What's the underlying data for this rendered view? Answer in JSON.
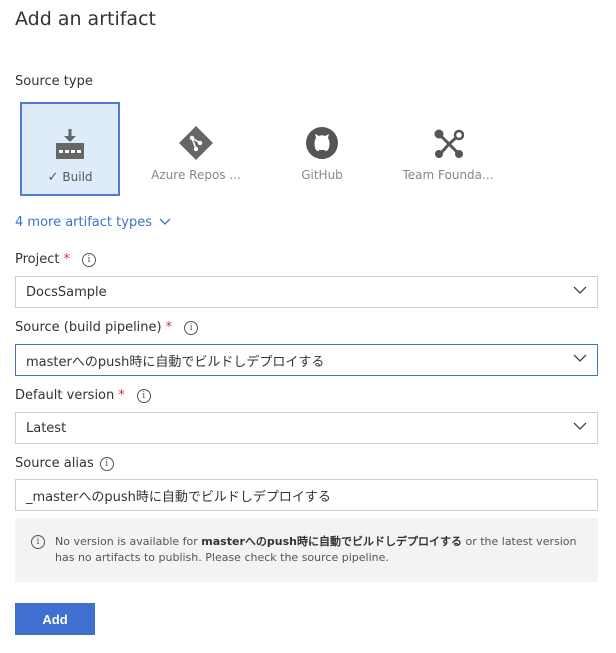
{
  "header": {
    "title": "Add an artifact"
  },
  "source_type": {
    "label": "Source type",
    "items": [
      {
        "label": "Build",
        "selected": true,
        "icon": "build-icon"
      },
      {
        "label": "Azure Repos ...",
        "selected": false,
        "icon": "git-icon"
      },
      {
        "label": "GitHub",
        "selected": false,
        "icon": "github-icon"
      },
      {
        "label": "Team Founda...",
        "selected": false,
        "icon": "tfvc-icon"
      }
    ],
    "more_link": "4 more artifact types"
  },
  "project": {
    "label": "Project",
    "value": "DocsSample"
  },
  "source": {
    "label": "Source (build pipeline)",
    "value": "masterへのpush時に自動でビルドしデプロイする"
  },
  "default_version": {
    "label": "Default version",
    "value": "Latest"
  },
  "source_alias": {
    "label": "Source alias",
    "value": "_masterへのpush時に自動でビルドしデプロイする"
  },
  "notice": {
    "prefix": "No version is available for ",
    "bold": "masterへのpush時に自動でビルドしデプロイする",
    "suffix": " or the latest version has no artifacts to publish. Please check the source pipeline."
  },
  "actions": {
    "add_label": "Add"
  },
  "colors": {
    "accent": "#3e6fd1",
    "selected_bg": "#deecf9",
    "required": "#d13438"
  }
}
